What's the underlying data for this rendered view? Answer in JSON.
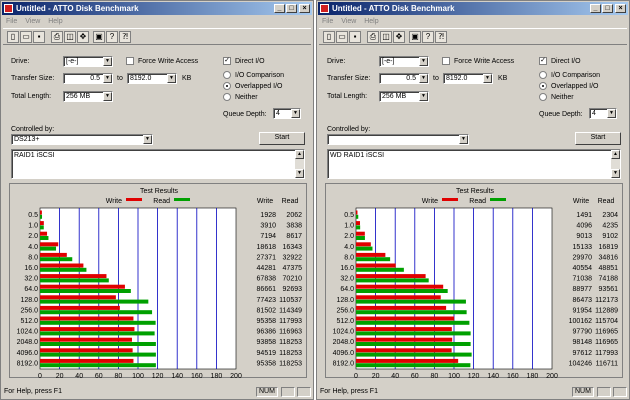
{
  "title": "Untitled - ATTO Disk Benchmark",
  "menu": [
    "File",
    "View",
    "Help"
  ],
  "labels": {
    "drive": "Drive:",
    "transfer_size": "Transfer Size:",
    "to": "to",
    "kb": "KB",
    "total_length": "Total Length:",
    "force_write": "Force Write Access",
    "direct_io": "Direct I/O",
    "io_comparison": "I/O Comparison",
    "overlapped": "Overlapped I/O",
    "neither": "Neither",
    "queue_depth": "Queue Depth:",
    "controlled_by": "Controlled by:",
    "start": "Start",
    "chart_title": "Test Results",
    "write": "Write",
    "read": "Read",
    "xlabel": "Transfer Rate - MB / Sec",
    "status": "For Help, press F1",
    "num": "NUM"
  },
  "colors": {
    "write": "#e00000",
    "read": "#00a000",
    "grid": "#0000c0"
  },
  "windows": [
    {
      "drive": "[-e-]",
      "ts_from": "0.5",
      "ts_to": "8192.0",
      "total_length": "256 MB",
      "queue_depth": "4",
      "controlled_by": "DS213+",
      "description": "RAID1 iSCSI",
      "force_write": false,
      "direct_io": true,
      "mode": "overlapped",
      "chart_data": {
        "type": "bar",
        "title": "Test Results",
        "xlabel": "Transfer Rate - MB / Sec",
        "xlim": [
          0,
          200
        ],
        "categories": [
          "0.5",
          "1.0",
          "2.0",
          "4.0",
          "8.0",
          "16.0",
          "32.0",
          "64.0",
          "128.0",
          "256.0",
          "512.0",
          "1024.0",
          "2048.0",
          "4096.0",
          "8192.0"
        ],
        "xticks": [
          "0",
          "20",
          "40",
          "60",
          "80",
          "100",
          "120",
          "140",
          "160",
          "180",
          "200"
        ],
        "series": [
          {
            "name": "Write",
            "values": [
              1928,
              3910,
              7194,
              18618,
              27371,
              44281,
              67838,
              86661,
              77423,
              81502,
              95358,
              96386,
              93858,
              94519,
              95358
            ]
          },
          {
            "name": "Read",
            "values": [
              2062,
              3838,
              8617,
              16343,
              32922,
              47375,
              70210,
              92693,
              110537,
              114349,
              117993,
              116963,
              118253,
              118253,
              118253
            ]
          }
        ]
      }
    },
    {
      "drive": "[-e-]",
      "ts_from": "0.5",
      "ts_to": "8192.0",
      "total_length": "256 MB",
      "queue_depth": "4",
      "controlled_by": "",
      "description": "WD RAID1 iSCSI",
      "force_write": false,
      "direct_io": true,
      "mode": "overlapped",
      "chart_data": {
        "type": "bar",
        "title": "Test Results",
        "xlabel": "Transfer Rate - MB / Sec",
        "xlim": [
          0,
          200
        ],
        "categories": [
          "0.5",
          "1.0",
          "2.0",
          "4.0",
          "8.0",
          "16.0",
          "32.0",
          "64.0",
          "128.0",
          "256.0",
          "512.0",
          "1024.0",
          "2048.0",
          "4096.0",
          "8192.0"
        ],
        "xticks": [
          "0",
          "20",
          "40",
          "60",
          "80",
          "100",
          "120",
          "140",
          "160",
          "180",
          "200"
        ],
        "series": [
          {
            "name": "Write",
            "values": [
              1491,
              4096,
              9013,
              15133,
              29970,
              40554,
              71038,
              88977,
              86473,
              91954,
              100162,
              97790,
              98148,
              97612,
              104246
            ]
          },
          {
            "name": "Read",
            "values": [
              2304,
              4235,
              9102,
              16819,
              34816,
              48851,
              74188,
              93561,
              112173,
              112889,
              115704,
              116965,
              116965,
              117993,
              116711
            ]
          }
        ]
      }
    }
  ]
}
